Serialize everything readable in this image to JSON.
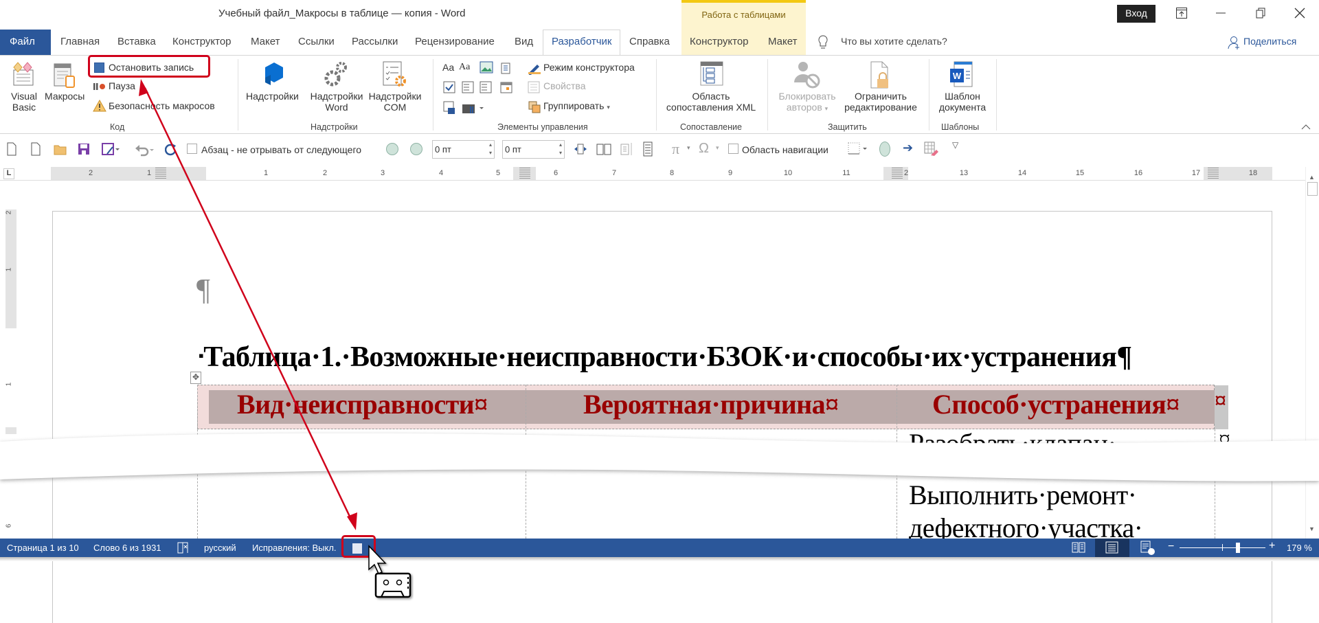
{
  "title_bar": {
    "title": "Учебный файл_Макросы в таблице — копия  -  Word",
    "context_group": "Работа с таблицами",
    "sign_in": "Вход"
  },
  "tabs": [
    {
      "label": "Файл"
    },
    {
      "label": "Главная"
    },
    {
      "label": "Вставка"
    },
    {
      "label": "Конструктор"
    },
    {
      "label": "Макет"
    },
    {
      "label": "Ссылки"
    },
    {
      "label": "Рассылки"
    },
    {
      "label": "Рецензирование"
    },
    {
      "label": "Вид"
    },
    {
      "label": "Разработчик",
      "selected": true
    },
    {
      "label": "Справка"
    },
    {
      "label": "Конструктор"
    },
    {
      "label": "Макет"
    }
  ],
  "tell_me": "Что вы хотите сделать?",
  "share": "Поделиться",
  "ribbon": {
    "code": {
      "label": "Код",
      "visual_basic": [
        "Visual",
        "Basic"
      ],
      "macros": "Макросы",
      "stop_recording": "Остановить запись",
      "pause": "Пауза",
      "macro_security": "Безопасность макросов"
    },
    "addins": {
      "label": "Надстройки",
      "addins": "Надстройки",
      "word_addins": [
        "Надстройки",
        "Word"
      ],
      "com_addins": [
        "Надстройки",
        "COM"
      ]
    },
    "controls": {
      "label": "Элементы управления",
      "design_mode": "Режим конструктора",
      "properties": "Свойства",
      "group": "Группировать"
    },
    "mapping": {
      "label": "Сопоставление",
      "xml_pane": [
        "Область",
        "сопоставления XML"
      ]
    },
    "protect": {
      "label": "Защитить",
      "block_authors": [
        "Блокировать",
        "авторов"
      ],
      "restrict_editing": [
        "Ограничить",
        "редактирование"
      ]
    },
    "templates": {
      "label": "Шаблоны",
      "document_template": [
        "Шаблон",
        "документа"
      ]
    }
  },
  "qat": {
    "keep_with_next": "Абзац - не отрывать от следующего",
    "keep_with_next_checked": false,
    "spacing_before": "0 пт",
    "spacing_after": "0 пт",
    "navigation_pane": "Область навигации",
    "navigation_pane_checked": false
  },
  "ruler": {
    "horizontal": [
      "2",
      "1",
      "1",
      "2",
      "3",
      "4",
      "5",
      "6",
      "7",
      "8",
      "9",
      "10",
      "11",
      "2",
      "13",
      "14",
      "15",
      "16",
      "17",
      "18"
    ],
    "vertical": [
      "2",
      "1",
      "1",
      "6"
    ]
  },
  "document": {
    "pilcrow": "¶",
    "heading_bullet": "▪",
    "heading": "Таблица·1.·Возможные·неисправности·БЗОК·и·способы·их·устранения¶",
    "table": {
      "headers": [
        "Вид·неисправности¤",
        "Вероятная·причина¤",
        "Способ·устранения¤"
      ],
      "row_end_mark": "¤",
      "col3_lines": [
        "Разобрать·клапан·",
        "Выполнить·ремонт·",
        "дефектного·участка·"
      ]
    }
  },
  "status_bar": {
    "page": "Страница 1 из 10",
    "words": "Слово 6 из 1931",
    "language": "русский",
    "track_changes": "Исправления: Выкл.",
    "zoom_label": "179 %",
    "zoom_percent": 179,
    "view": "print-layout"
  },
  "colors": {
    "word_blue": "#2b579a",
    "header_text": "#990000",
    "header_band": "#bbaaa9",
    "header_bg": "#f2dcdb",
    "annotation_red": "#d0021b",
    "context_tab": "#fdf4cf"
  }
}
